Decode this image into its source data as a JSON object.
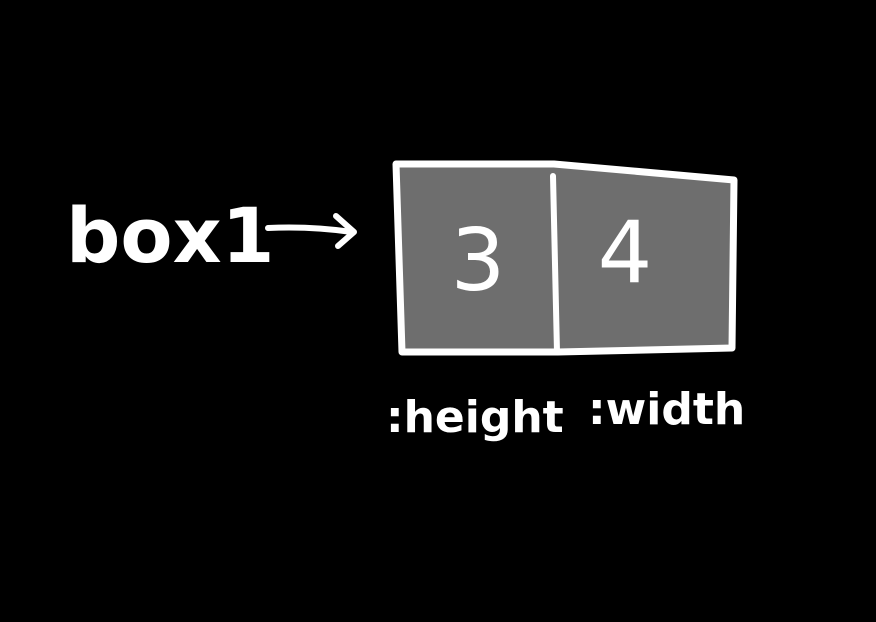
{
  "variable_label": "box1",
  "cells": [
    {
      "value": "3",
      "key": ":height"
    },
    {
      "value": "4",
      "key": ":width"
    }
  ],
  "colors": {
    "background": "#000000",
    "ink": "#ffffff",
    "cell_fill": "#6e6e6e"
  }
}
